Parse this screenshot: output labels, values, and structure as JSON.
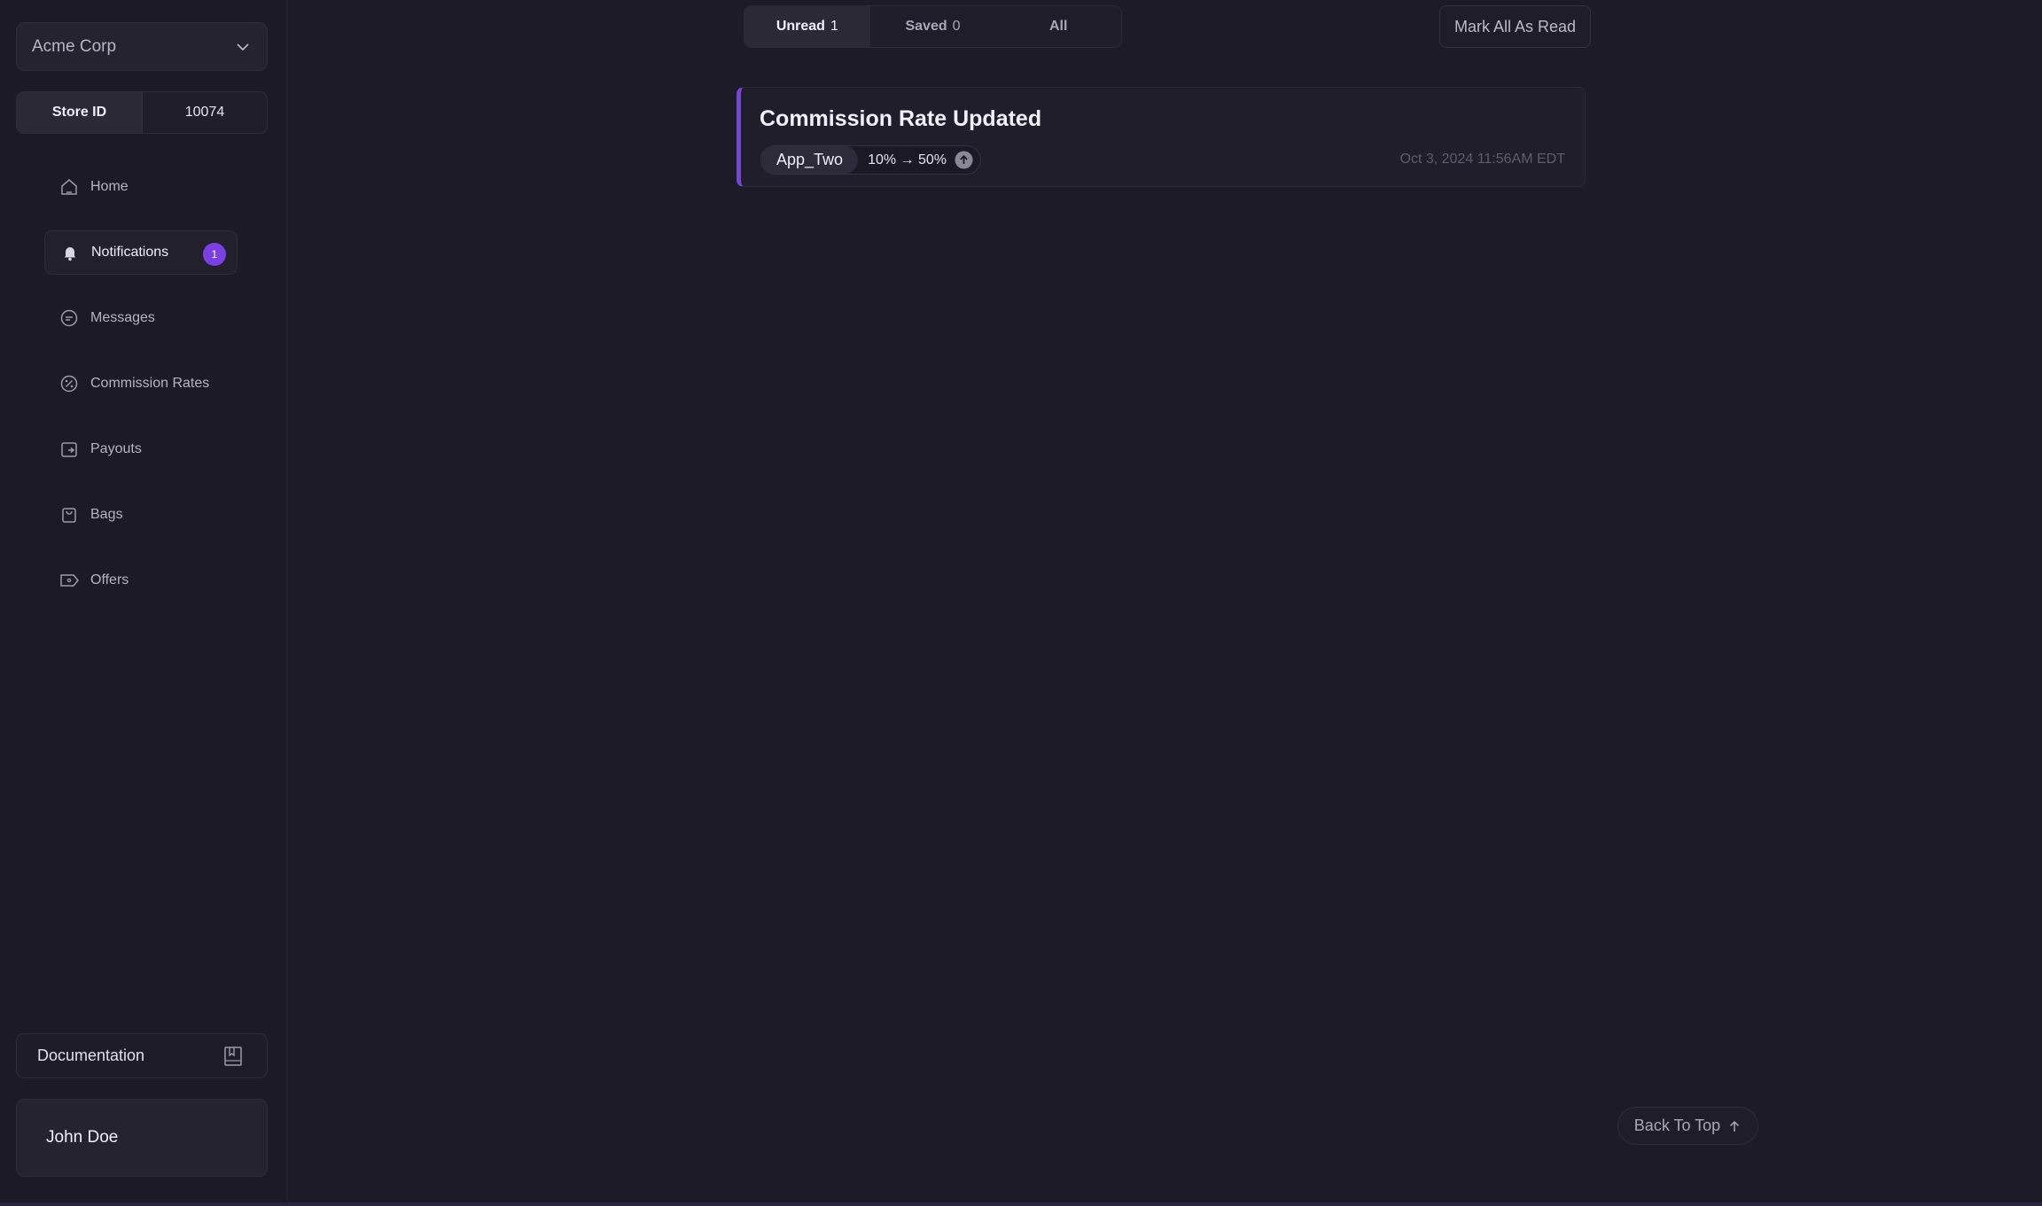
{
  "sidebar": {
    "org_name": "Acme Corp",
    "store_id_label": "Store ID",
    "store_id_value": "10074",
    "nav": [
      {
        "label": "Home",
        "icon": "home-icon"
      },
      {
        "label": "Notifications",
        "icon": "bell-icon",
        "badge": "1",
        "active": true
      },
      {
        "label": "Messages",
        "icon": "chat-icon"
      },
      {
        "label": "Commission Rates",
        "icon": "percent-icon"
      },
      {
        "label": "Payouts",
        "icon": "wallet-icon"
      },
      {
        "label": "Bags",
        "icon": "bag-icon"
      },
      {
        "label": "Offers",
        "icon": "tag-icon"
      }
    ],
    "documentation_label": "Documentation",
    "user_name": "John Doe"
  },
  "tabs": [
    {
      "label": "Unread",
      "count": "1",
      "active": true
    },
    {
      "label": "Saved",
      "count": "0"
    },
    {
      "label": "All",
      "count": ""
    }
  ],
  "mark_all_label": "Mark All As Read",
  "notification": {
    "title": "Commission Rate Updated",
    "app": "App_Two",
    "rate_change": "10% → 50%",
    "timestamp": "Oct 3, 2024 11:56AM EDT"
  },
  "back_to_top_label": "Back To Top",
  "colors": {
    "accent": "#7b3fe6",
    "background": "#1d1b27",
    "panel": "#201e2b"
  }
}
